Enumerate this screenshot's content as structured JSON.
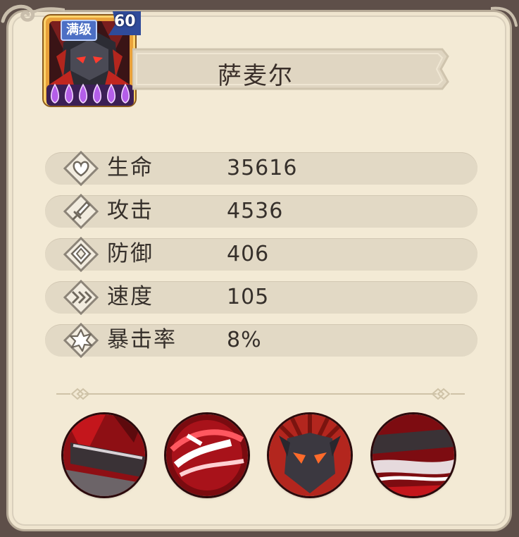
{
  "hero": {
    "name": "萨麦尔",
    "level": "60",
    "max_badge": "满级",
    "stars": 6,
    "star_color": "#b45ee8"
  },
  "stats": [
    {
      "label": "生命",
      "value": "35616",
      "icon": "heart-icon"
    },
    {
      "label": "攻击",
      "value": "4536",
      "icon": "sword-icon"
    },
    {
      "label": "防御",
      "value": "406",
      "icon": "shield-icon"
    },
    {
      "label": "速度",
      "value": "105",
      "icon": "speed-icon"
    },
    {
      "label": "暴击率",
      "value": "8%",
      "icon": "crit-burst-icon"
    }
  ],
  "skills": [
    {
      "icon": "skill-blade-slash-icon"
    },
    {
      "icon": "skill-crimson-swirl-icon"
    },
    {
      "icon": "skill-demon-mask-icon"
    },
    {
      "icon": "skill-red-streak-icon"
    }
  ],
  "colors": {
    "panel": "#f3ead5",
    "stat_row": "#e2d9c5",
    "text": "#36302b",
    "accent_red": "#c4161c"
  }
}
